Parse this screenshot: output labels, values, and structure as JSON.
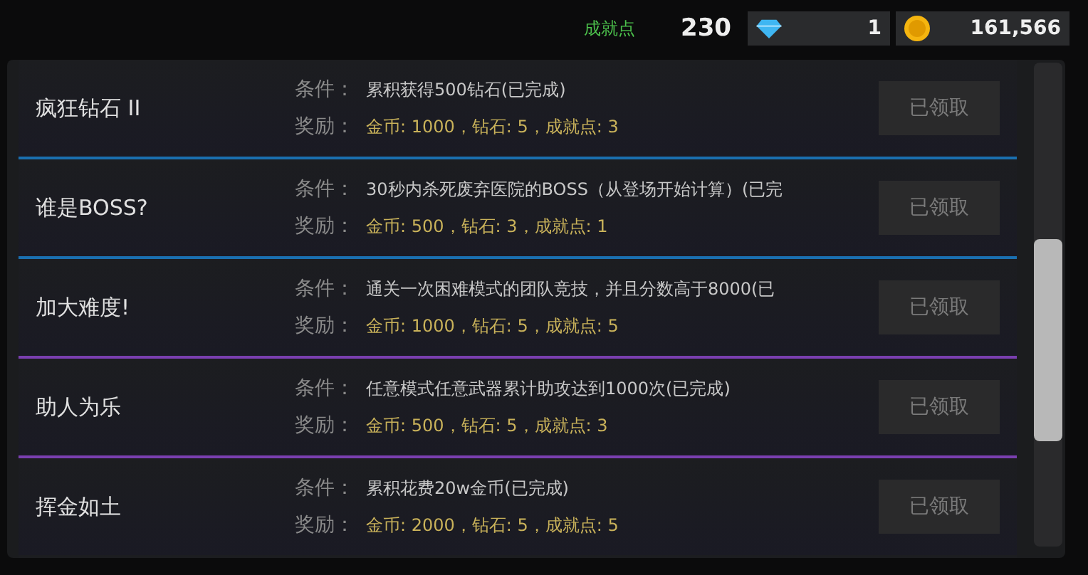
{
  "top_bar": {
    "points_label": "成就点",
    "points": "230",
    "diamonds": "1",
    "coins": "161,566"
  },
  "achievements": [
    {
      "name": "疯狂钻石 II",
      "condition_label": "条件：",
      "condition": "累积获得500钻石(已完成)",
      "reward_label": "奖励：",
      "reward": "金币: 1000，钻石: 5，成就点: 3",
      "button": "已领取",
      "claimed": true,
      "color": "#1a6fb0"
    },
    {
      "name": "谁是BOSS?",
      "condition_label": "条件：",
      "condition": "30秒内杀死废弃医院的BOSS（从登场开始计算）(已完",
      "reward_label": "奖励：",
      "reward": "金币: 500，钻石: 3，成就点: 1",
      "button": "已领取",
      "claimed": true,
      "color": "#1a6fb0"
    },
    {
      "name": "加大难度!",
      "condition_label": "条件：",
      "condition": "通关一次困难模式的团队竞技，并且分数高于8000(已",
      "reward_label": "奖励：",
      "reward": "金币: 1000，钻石: 5，成就点: 5",
      "button": "已领取",
      "claimed": true,
      "color": "#7a3fb0"
    },
    {
      "name": "助人为乐",
      "condition_label": "条件：",
      "condition": "任意模式任意武器累计助攻达到1000次(已完成)",
      "reward_label": "奖励：",
      "reward": "金币: 500，钻石: 5，成就点: 3",
      "button": "已领取",
      "claimed": true,
      "color": "#7a3fb0"
    },
    {
      "name": "挥金如土",
      "condition_label": "条件：",
      "condition": "累积花费20w金币(已完成)",
      "reward_label": "奖励：",
      "reward": "金币: 2000，钻石: 5，成就点: 5",
      "button": "已领取",
      "claimed": true
    }
  ]
}
